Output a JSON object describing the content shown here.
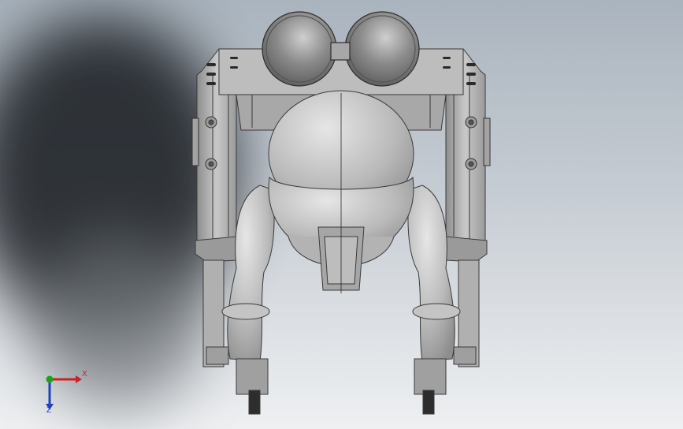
{
  "viewport": {
    "background_top": "#aab4be",
    "background_bottom": "#eef0f2",
    "model": {
      "body_color": "#b9b9b9",
      "frame_color": "#a9a9a9",
      "edge_color": "#3a3a3a",
      "dome_color": "#7d7d7d"
    }
  },
  "triad": {
    "x_label": "X",
    "z_label": "Z",
    "x_color": "#d02020",
    "y_color": "#20a020",
    "z_color": "#2040c0"
  }
}
